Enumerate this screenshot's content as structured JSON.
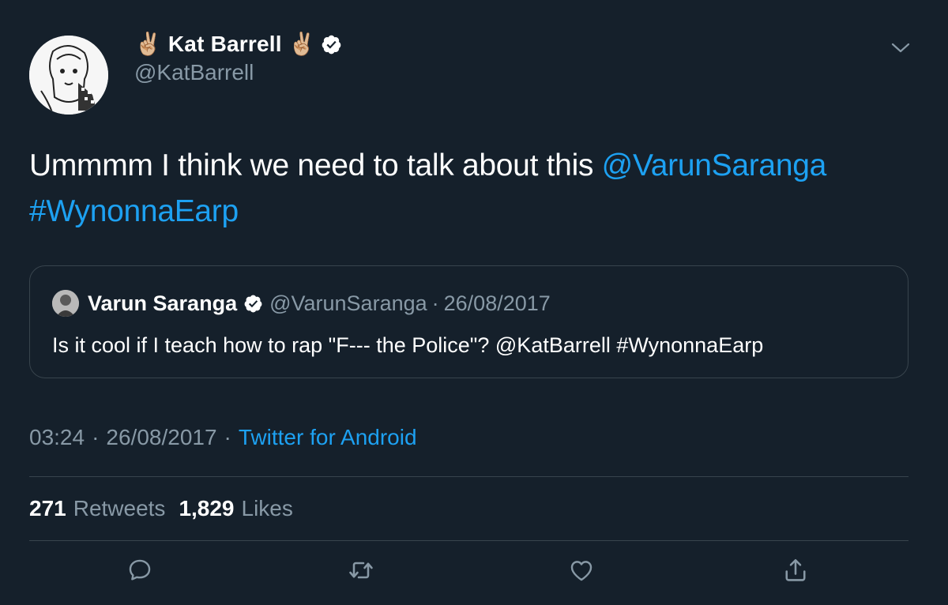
{
  "header": {
    "display_name": "Kat Barrell",
    "emoji_left": "✌🏼",
    "emoji_right": "✌🏼",
    "handle": "@KatBarrell"
  },
  "tweet": {
    "text": "Ummmm I think we need to talk about this ",
    "mention": "@VarunSaranga",
    "hashtag": "#WynonnaEarp"
  },
  "quote": {
    "name": "Varun Saranga",
    "handle": "@VarunSaranga",
    "separator": "·",
    "date": "26/08/2017",
    "text": "Is it cool if I teach how to rap \"F--- the Police\"? @KatBarrell #WynonnaEarp"
  },
  "meta": {
    "time": "03:24",
    "separator": "·",
    "date": "26/08/2017",
    "source": "Twitter for Android"
  },
  "stats": {
    "retweets_count": "271",
    "retweets_label": "Retweets",
    "likes_count": "1,829",
    "likes_label": "Likes"
  },
  "actions": {
    "icons": [
      "reply-icon",
      "retweet-icon",
      "like-icon",
      "share-icon"
    ]
  },
  "colors": {
    "background": "#15202b",
    "accent": "#1da1f2",
    "secondary_text": "#8899a6",
    "border": "#38444d"
  }
}
